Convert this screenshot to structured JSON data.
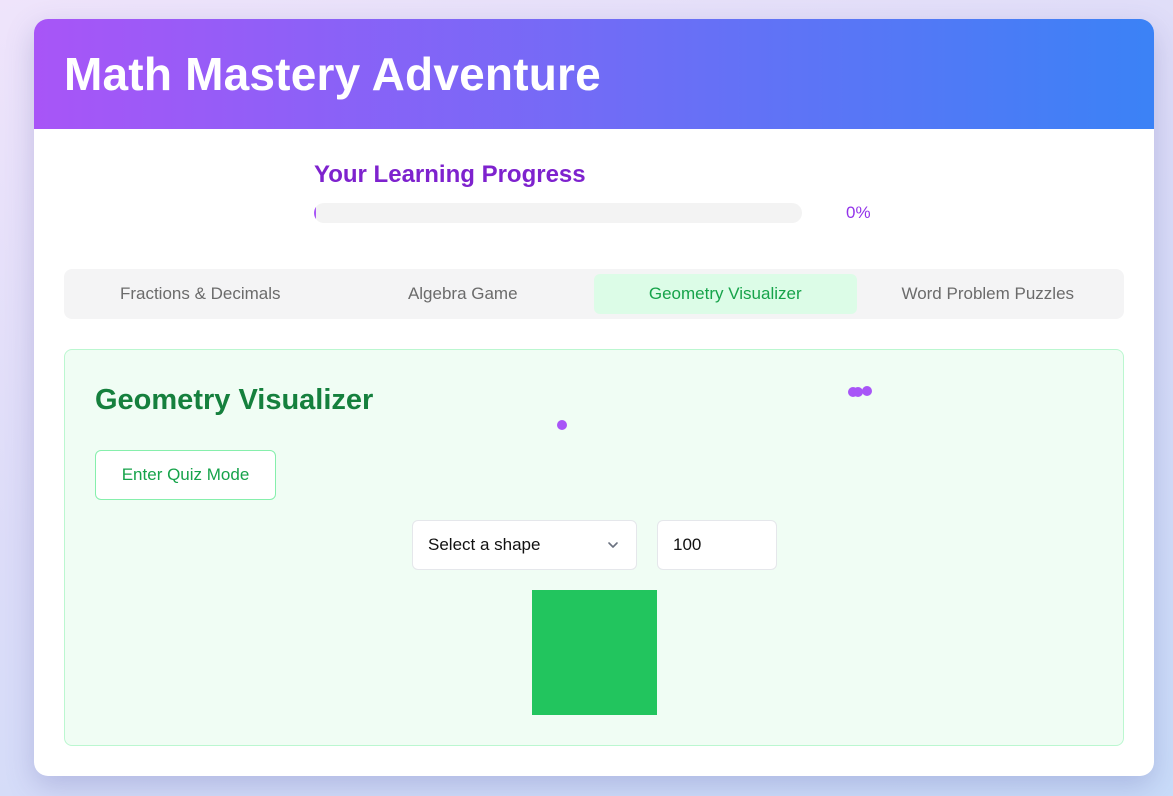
{
  "header": {
    "title": "Math Mastery Adventure"
  },
  "progress": {
    "title": "Your Learning Progress",
    "percent_label": "0%",
    "value": 0
  },
  "tabs": [
    {
      "label": "Fractions & Decimals",
      "active": false
    },
    {
      "label": "Algebra Game",
      "active": false
    },
    {
      "label": "Geometry Visualizer",
      "active": true
    },
    {
      "label": "Word Problem Puzzles",
      "active": false
    }
  ],
  "panel": {
    "title": "Geometry Visualizer",
    "quiz_button": "Enter Quiz Mode",
    "shape_select": {
      "selected": "Select a shape"
    },
    "size_input": {
      "value": "100"
    }
  },
  "colors": {
    "header_gradient_start": "#a855f7",
    "header_gradient_end": "#3b82f6",
    "accent_purple": "#7e22ce",
    "accent_green": "#16a34a",
    "shape_fill": "#22c55e",
    "particle": "#a855f7"
  },
  "icons": {
    "select_arrow": "chevron-down-icon"
  }
}
